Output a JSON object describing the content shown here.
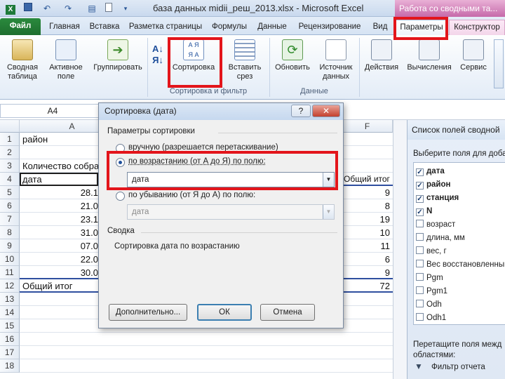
{
  "window": {
    "title": "база данных midii_реш_2013.xlsx - Microsoft Excel",
    "contextual_title": "Работа со сводными та..."
  },
  "tabs": [
    {
      "label": "Файл"
    },
    {
      "label": "Главная"
    },
    {
      "label": "Вставка"
    },
    {
      "label": "Разметка страницы"
    },
    {
      "label": "Формулы"
    },
    {
      "label": "Данные"
    },
    {
      "label": "Рецензирование"
    },
    {
      "label": "Вид"
    },
    {
      "label": "Параметры"
    },
    {
      "label": "Конструктор"
    }
  ],
  "ribbon": {
    "pivot_table": "Сводная\nтаблица",
    "active_field": "Активное\nполе",
    "group": "Группировать",
    "sort": "Сортировка",
    "insert_slicer": "Вставить\nсрез",
    "refresh": "Обновить",
    "data_source": "Источник\nданных",
    "actions": "Действия",
    "calculations": "Вычисления",
    "service": "Сервис",
    "group_sort_filter": "Сортировка и фильтр",
    "group_data": "Данные"
  },
  "namebox": "A4",
  "columns": [
    "A",
    "F"
  ],
  "rows": [
    "1",
    "2",
    "3",
    "4",
    "5",
    "6",
    "7",
    "8",
    "9",
    "10",
    "11",
    "12",
    "13",
    "14",
    "15",
    "16",
    "17",
    "18"
  ],
  "cells": {
    "a1": "район",
    "a3": "Количество собра",
    "a4": "дата",
    "f4": "Общий итог",
    "a5": "28.1",
    "f5": "9",
    "a6": "21.0",
    "f6": "8",
    "a7": "23.1",
    "f7": "19",
    "a8": "31.0",
    "f8": "10",
    "a9": "07.0",
    "f9": "11",
    "a10": "22.0",
    "f10": "6",
    "a11": "30.0",
    "f11": "9",
    "a12": "Общий итог",
    "f12": "72"
  },
  "field_pane": {
    "title": "Список полей сводной",
    "choose_label": "Выберите поля для доба",
    "fields": [
      {
        "name": "дата",
        "checked": true
      },
      {
        "name": "район",
        "checked": true
      },
      {
        "name": "станция",
        "checked": true
      },
      {
        "name": "N",
        "checked": true
      },
      {
        "name": "возраст",
        "checked": false
      },
      {
        "name": "длина, мм",
        "checked": false
      },
      {
        "name": "вес, г",
        "checked": false
      },
      {
        "name": "Вес восстановленный",
        "checked": false
      },
      {
        "name": "Pgm",
        "checked": false
      },
      {
        "name": "Pgm1",
        "checked": false
      },
      {
        "name": "Odh",
        "checked": false
      },
      {
        "name": "Odh1",
        "checked": false
      }
    ],
    "drag_label": "Перетащите поля межд",
    "areas_label": "областями:",
    "report_filter": "Фильтр отчета"
  },
  "dialog": {
    "title": "Сортировка (дата)",
    "help": "?",
    "close": "✕",
    "sort_options_label": "Параметры сортировки",
    "manual_label": "вручную (разрешается перетаскивание)",
    "asc_label": "по возрастанию (от А до Я) по полю:",
    "asc_field": "дата",
    "desc_label": "по убыванию (от Я до А) по полю:",
    "desc_field": "дата",
    "summary_label": "Сводка",
    "summary_text": "Сортировка дата по возрастанию",
    "more_button": "Дополнительно...",
    "ok_button": "ОК",
    "cancel_button": "Отмена"
  },
  "colors": {
    "highlight": "#e3151b",
    "file_tab": "#1e6e2f",
    "pivot_tools": "#c66aaa"
  }
}
